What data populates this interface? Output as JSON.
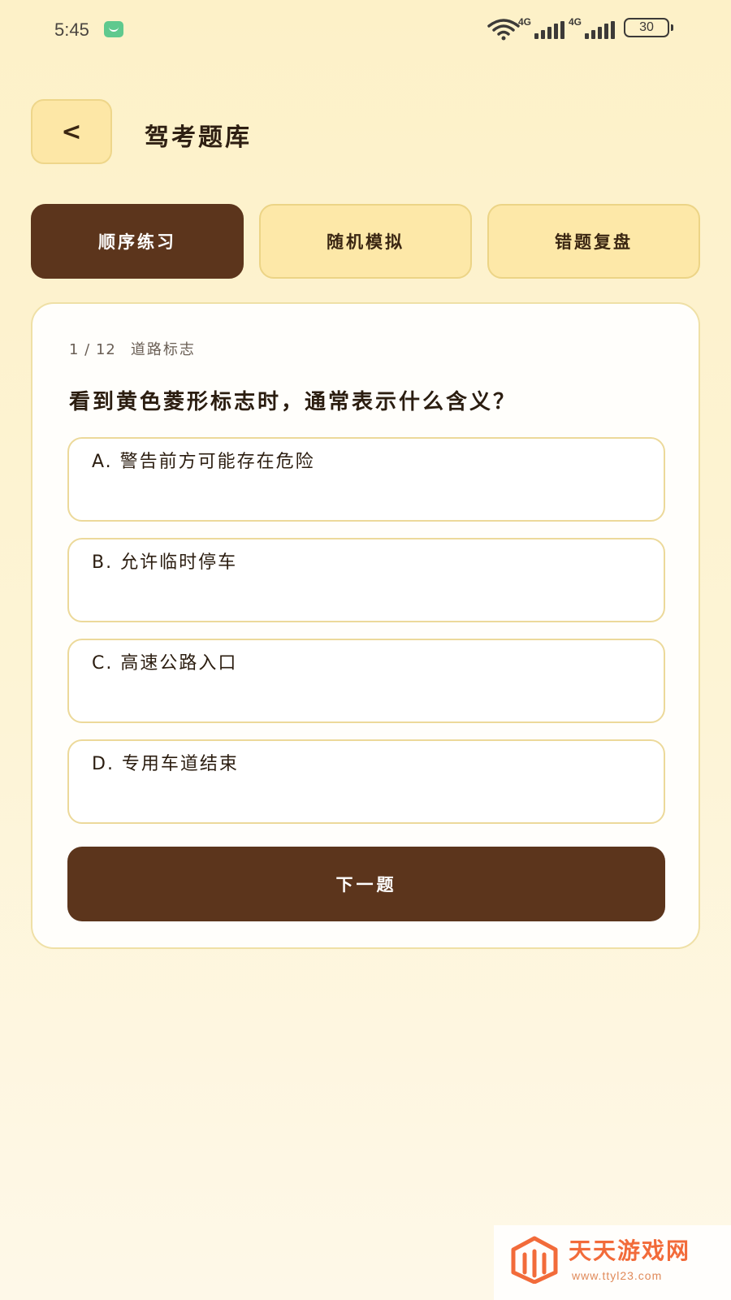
{
  "status_bar": {
    "time": "5:45",
    "signal_1_label": "4G",
    "signal_2_label": "4G",
    "battery": "30"
  },
  "header": {
    "back_label": "<",
    "title": "驾考题库"
  },
  "tabs": [
    {
      "label": "顺序练习",
      "active": true
    },
    {
      "label": "随机模拟",
      "active": false
    },
    {
      "label": "错题复盘",
      "active": false
    }
  ],
  "quiz": {
    "progress": "1 / 12",
    "category": "道路标志",
    "question": "看到黄色菱形标志时，通常表示什么含义？",
    "options": [
      "A. 警告前方可能存在危险",
      "B. 允许临时停车",
      "C. 高速公路入口",
      "D. 专用车道结束"
    ],
    "next_label": "下一题"
  },
  "watermark": {
    "name": "天天游戏网",
    "url": "www.ttyl23.com"
  },
  "colors": {
    "primary_dark": "#5c351c",
    "tab_inactive": "#fde8a8",
    "background": "#fdf1c8",
    "watermark": "#f26b3a"
  }
}
